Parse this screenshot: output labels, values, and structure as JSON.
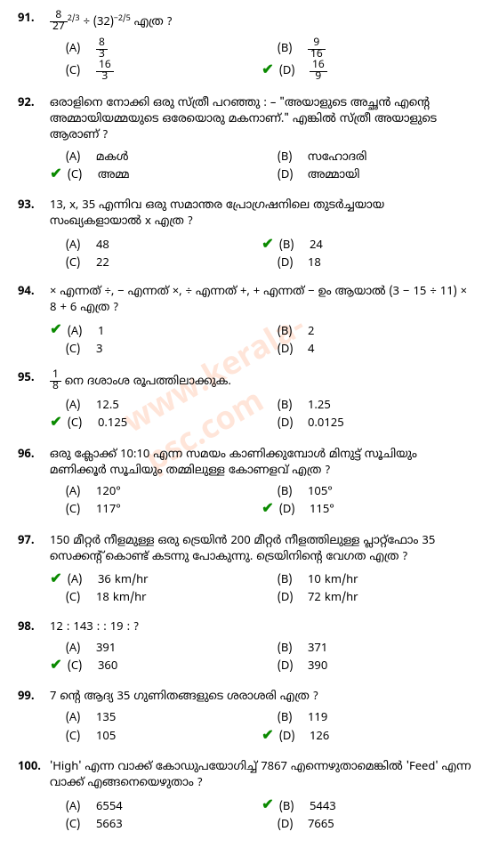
{
  "questions": [
    {
      "num": "91.",
      "text_html": "<span class='frac'><span class='num'>8</span><span class='den'>27</span></span><sup>2/3</sup> ÷ (32)<sup>−2/5</sup> എത്ര ?",
      "options": [
        {
          "label": "(A)",
          "value_html": "<span class='frac'><span class='num'>8</span><span class='den'>3</span></span>",
          "correct": false
        },
        {
          "label": "(B)",
          "value_html": "<span class='frac'><span class='num'>9</span><span class='den'>16</span></span>",
          "correct": false
        },
        {
          "label": "(C)",
          "value_html": "<span class='frac'><span class='num'>16</span><span class='den'>3</span></span>",
          "correct": false
        },
        {
          "label": "(D)",
          "value_html": "<span class='frac'><span class='num'>16</span><span class='den'>9</span></span>",
          "correct": true
        }
      ]
    },
    {
      "num": "92.",
      "text": "ഒരാളിനെ നോക്കി ഒരു സ്ത്രീ പറഞ്ഞു : – \"അയാളുടെ അച്ഛൻ എന്റെ അമ്മായിയമ്മയുടെ ഒരേയൊരു മകനാണ്.\" എങ്കിൽ സ്ത്രീ അയാളുടെ ആരാണ് ?",
      "options": [
        {
          "label": "(A)",
          "value": "മകൾ",
          "correct": false
        },
        {
          "label": "(B)",
          "value": "സഹോദരി",
          "correct": false
        },
        {
          "label": "(C)",
          "value": "അമ്മ",
          "correct": true
        },
        {
          "label": "(D)",
          "value": "അമ്മായി",
          "correct": false
        }
      ]
    },
    {
      "num": "93.",
      "text": "13, x, 35 എന്നിവ ഒരു സമാന്തര പ്രോഗ്രഷനിലെ തുടർച്ചയായ സംഖ്യകളായാൽ x എത്ര ?",
      "options": [
        {
          "label": "(A)",
          "value": "48",
          "correct": false
        },
        {
          "label": "(B)",
          "value": "24",
          "correct": true
        },
        {
          "label": "(C)",
          "value": "22",
          "correct": false
        },
        {
          "label": "(D)",
          "value": "18",
          "correct": false
        }
      ]
    },
    {
      "num": "94.",
      "text": "× എന്നത് ÷, − എന്നത് ×, ÷ എന്നത് +, + എന്നത് − ഉം ആയാൽ (3 − 15 ÷ 11) × 8 + 6  എത്ര ?",
      "options": [
        {
          "label": "(A)",
          "value": "1",
          "correct": true
        },
        {
          "label": "(B)",
          "value": "2",
          "correct": false
        },
        {
          "label": "(C)",
          "value": "3",
          "correct": false
        },
        {
          "label": "(D)",
          "value": "4",
          "correct": false
        }
      ]
    },
    {
      "num": "95.",
      "text_html": "<span class='frac'><span class='num'>1</span><span class='den'>8</span></span> നെ ദശാംശ രൂപത്തിലാക്കുക.",
      "options": [
        {
          "label": "(A)",
          "value": "12.5",
          "correct": false
        },
        {
          "label": "(B)",
          "value": "1.25",
          "correct": false
        },
        {
          "label": "(C)",
          "value": "0.125",
          "correct": true
        },
        {
          "label": "(D)",
          "value": "0.0125",
          "correct": false
        }
      ]
    },
    {
      "num": "96.",
      "text": "ഒരു ക്ലോക്ക് 10:10 എന്ന സമയം കാണിക്കുമ്പോൾ മിനുട്ട് സൂചിയും മണിക്കൂർ സൂചിയും തമ്മിലുള്ള കോണളവ് എത്ര ?",
      "options": [
        {
          "label": "(A)",
          "value": "120°",
          "correct": false
        },
        {
          "label": "(B)",
          "value": "105°",
          "correct": false
        },
        {
          "label": "(C)",
          "value": "117°",
          "correct": false
        },
        {
          "label": "(D)",
          "value": "115°",
          "correct": true
        }
      ]
    },
    {
      "num": "97.",
      "text": "150 മീറ്റർ നീളമുള്ള ഒരു ട്രെയിൻ 200 മീറ്റർ നീളത്തിലുള്ള പ്ലാറ്റ്ഫോം 35 സെക്കന്റ് കൊണ്ട് കടന്നു പോകുന്നു. ട്രെയിനിന്റെ വേഗത എത്ര ?",
      "options": [
        {
          "label": "(A)",
          "value": "36 km/hr",
          "correct": true
        },
        {
          "label": "(B)",
          "value": "10 km/hr",
          "correct": false
        },
        {
          "label": "(C)",
          "value": "18 km/hr",
          "correct": false
        },
        {
          "label": "(D)",
          "value": "72 km/hr",
          "correct": false
        }
      ]
    },
    {
      "num": "98.",
      "text": "12 : 143 : : 19 : ?",
      "options": [
        {
          "label": "(A)",
          "value": "391",
          "correct": false
        },
        {
          "label": "(B)",
          "value": "371",
          "correct": false
        },
        {
          "label": "(C)",
          "value": "360",
          "correct": true
        },
        {
          "label": "(D)",
          "value": "390",
          "correct": false
        }
      ]
    },
    {
      "num": "99.",
      "text": "7 ന്റെ ആദ്യ 35 ഗുണിതങ്ങളുടെ ശരാശരി എത്ര ?",
      "options": [
        {
          "label": "(A)",
          "value": "135",
          "correct": false
        },
        {
          "label": "(B)",
          "value": "119",
          "correct": false
        },
        {
          "label": "(C)",
          "value": "105",
          "correct": false
        },
        {
          "label": "(D)",
          "value": "126",
          "correct": true
        }
      ]
    },
    {
      "num": "100.",
      "text": "'High' എന്ന വാക്ക് കോഡുപയോഗിച്ച് 7867 എന്നെഴുതാമെങ്കിൽ 'Feed' എന്ന വാക്ക് എങ്ങനെയെഴുതാം ?",
      "options": [
        {
          "label": "(A)",
          "value": "6554",
          "correct": false
        },
        {
          "label": "(B)",
          "value": "5443",
          "correct": true
        },
        {
          "label": "(C)",
          "value": "5663",
          "correct": false
        },
        {
          "label": "(D)",
          "value": "7665",
          "correct": false
        }
      ]
    }
  ]
}
